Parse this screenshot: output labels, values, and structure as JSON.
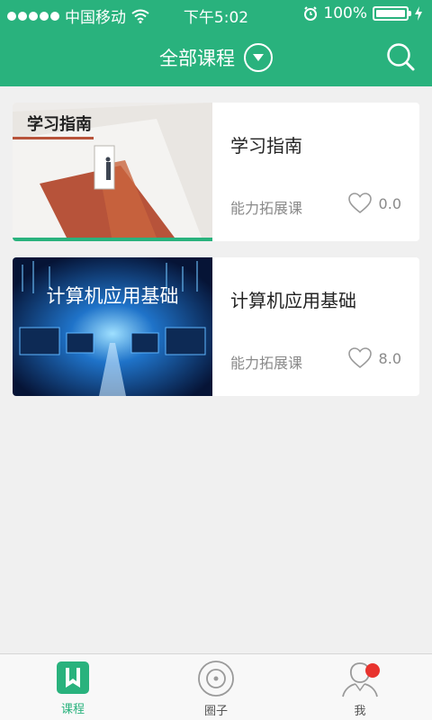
{
  "status_bar": {
    "carrier": "中国移动",
    "time": "下午5:02",
    "battery_percent": "100%",
    "battery_level": 1.0
  },
  "nav": {
    "title": "全部课程"
  },
  "courses": [
    {
      "thumb_text": "学习指南",
      "title": "学习指南",
      "category": "能力拓展课",
      "likes": "0.0"
    },
    {
      "thumb_text": "计算机应用基础",
      "title": "计算机应用基础",
      "category": "能力拓展课",
      "likes": "8.0"
    }
  ],
  "tabbar": {
    "items": [
      {
        "label": "课程",
        "icon": "book-icon",
        "active": true
      },
      {
        "label": "圈子",
        "icon": "circle-icon",
        "active": false
      },
      {
        "label": "我",
        "icon": "profile-icon",
        "active": false,
        "badge": true
      }
    ]
  },
  "colors": {
    "accent": "#29b27d",
    "badge": "#e8332e"
  }
}
